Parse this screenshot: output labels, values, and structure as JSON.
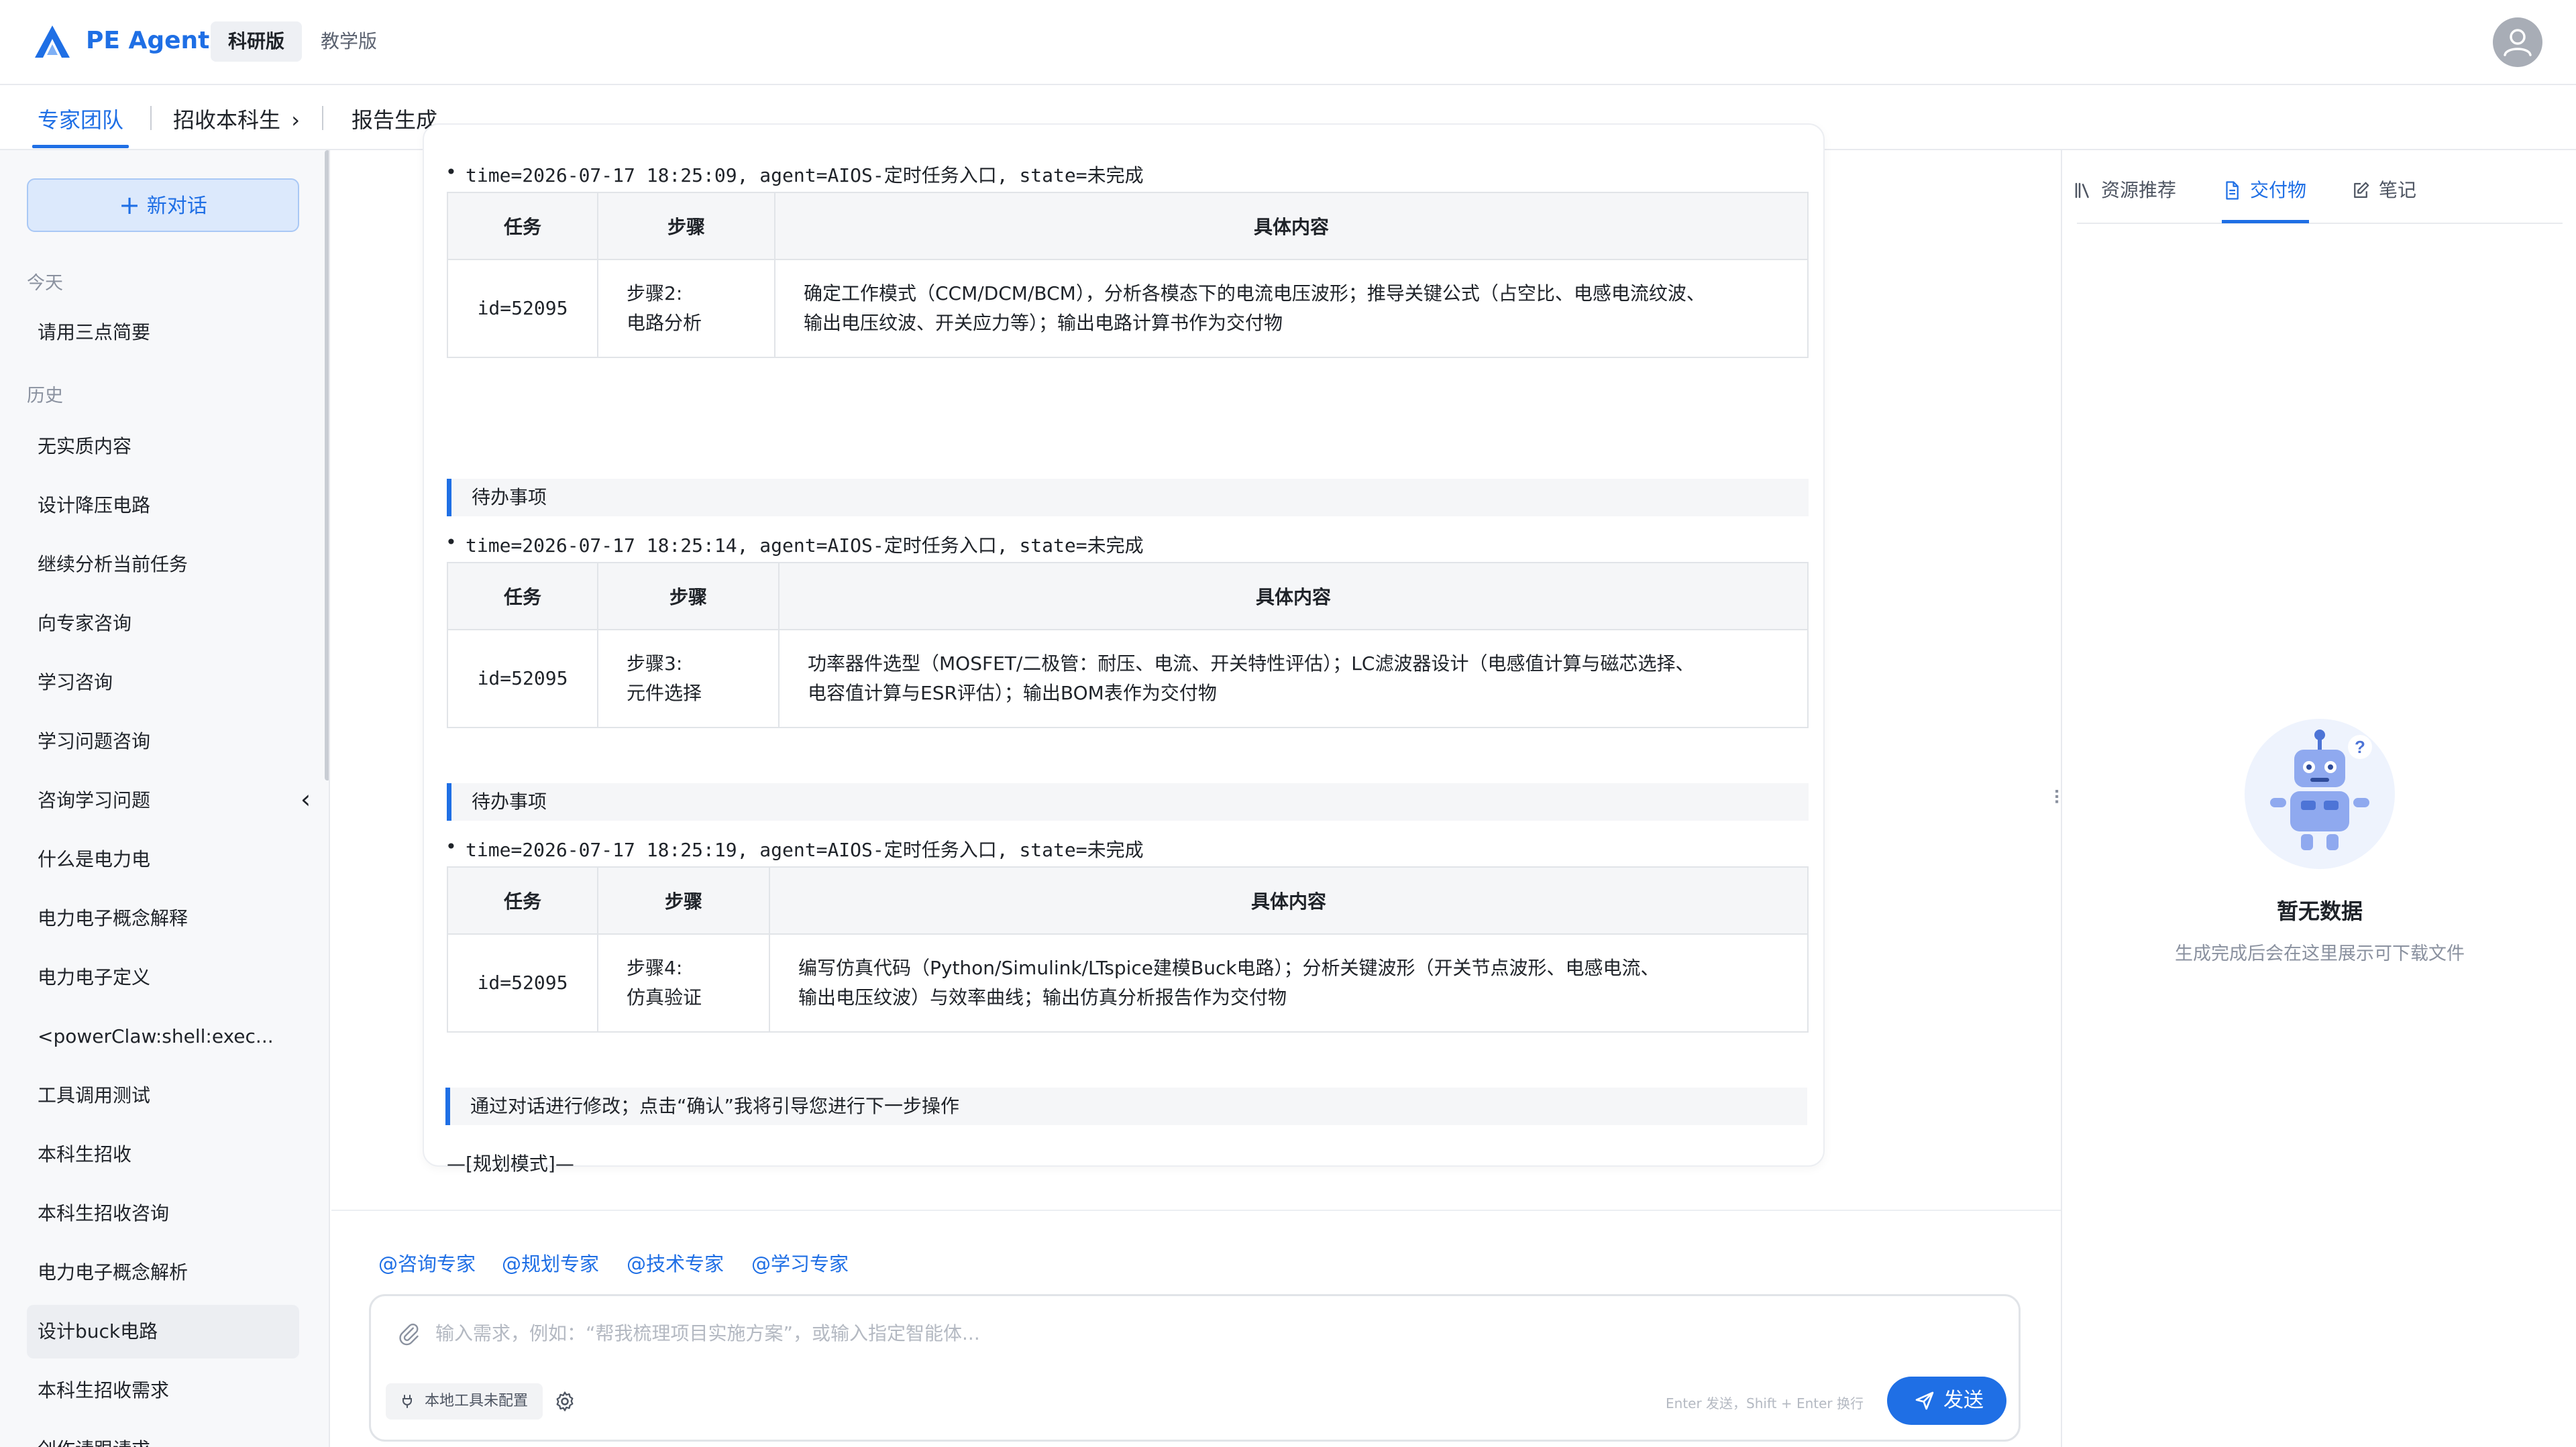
{
  "app": {
    "name": "PE Agent",
    "versions": [
      "科研版",
      "教学版"
    ],
    "brand_color": "#1f6fe5"
  },
  "nav": {
    "tabs": [
      "专家团队",
      "招收本科生",
      "报告生成"
    ]
  },
  "sidebar": {
    "new_chat_label": "新对话",
    "today_label": "今天",
    "today_items": [
      "请用三点简要"
    ],
    "history_label": "历史",
    "history_items": [
      "无实质内容",
      "设计降压电路",
      "继续分析当前任务",
      "向专家咨询",
      "学习咨询",
      "学习问题咨询",
      "咨询学习问题",
      "什么是电力电",
      "电力电子概念解释",
      "电力电子定义",
      "<powerClaw:shell:exec...",
      "工具调用测试",
      "本科生招收",
      "本科生招收咨询",
      "电力电子概念解析",
      "设计buck电路",
      "本科生招收需求",
      "创作请跟请求"
    ],
    "selected": "设计buck电路"
  },
  "message": {
    "bullets": [
      "time=2026-07-17 18:25:09, agent=AIOS-定时任务入口, state=未完成",
      "time=2026-07-17 18:25:14, agent=AIOS-定时任务入口, state=未完成",
      "time=2026-07-17 18:25:19, agent=AIOS-定时任务入口, state=未完成"
    ],
    "table_headers": [
      "任务",
      "步骤",
      "具体内容"
    ],
    "tables": [
      {
        "id": "id=52095",
        "step": "步骤2:",
        "step_name": "电路分析",
        "content_l1": "确定工作模式（CCM/DCM/BCM），分析各模态下的电流电压波形；推导关键公式（占空比、电感电流纹波、",
        "content_l2": "输出电压纹波、开关应力等）；输出电路计算书作为交付物"
      },
      {
        "id": "id=52095",
        "step": "步骤3:",
        "step_name": "元件选择",
        "content_l1": "功率器件选型（MOSFET/二极管：耐压、电流、开关特性评估）；LC滤波器设计（电感值计算与磁芯选择、",
        "content_l2": "电容值计算与ESR评估）；输出BOM表作为交付物"
      },
      {
        "id": "id=52095",
        "step": "步骤4:",
        "step_name": "仿真验证",
        "content_l1": "编写仿真代码（Python/Simulink/LTspice建模Buck电路）；分析关键波形（开关节点波形、电感电流、",
        "content_l2": "输出电压纹波）与效率曲线；输出仿真分析报告作为交付物"
      }
    ],
    "todo_label": "待办事项",
    "separator": "—=—=—=—",
    "mode_line": "—[规划模式]—",
    "confirm_note": "通过对话进行修改；点击“确认”我将引导您进行下一步操作"
  },
  "composer": {
    "mentions": [
      "@咨询专家",
      "@规划专家",
      "@技术专家",
      "@学习专家"
    ],
    "placeholder": "输入需求，例如：“帮我梳理项目实施方案”，或输入指定智能体...",
    "tool_chip": "本地工具未配置",
    "hint": "Enter 发送，Shift + Enter 换行",
    "send_label": "发送"
  },
  "right_panel": {
    "tabs": [
      "资源推荐",
      "交付物",
      "笔记"
    ],
    "active_tab": "交付物",
    "empty_title": "暂无数据",
    "empty_subtitle": "生成完成后会在这里展示可下载文件"
  }
}
